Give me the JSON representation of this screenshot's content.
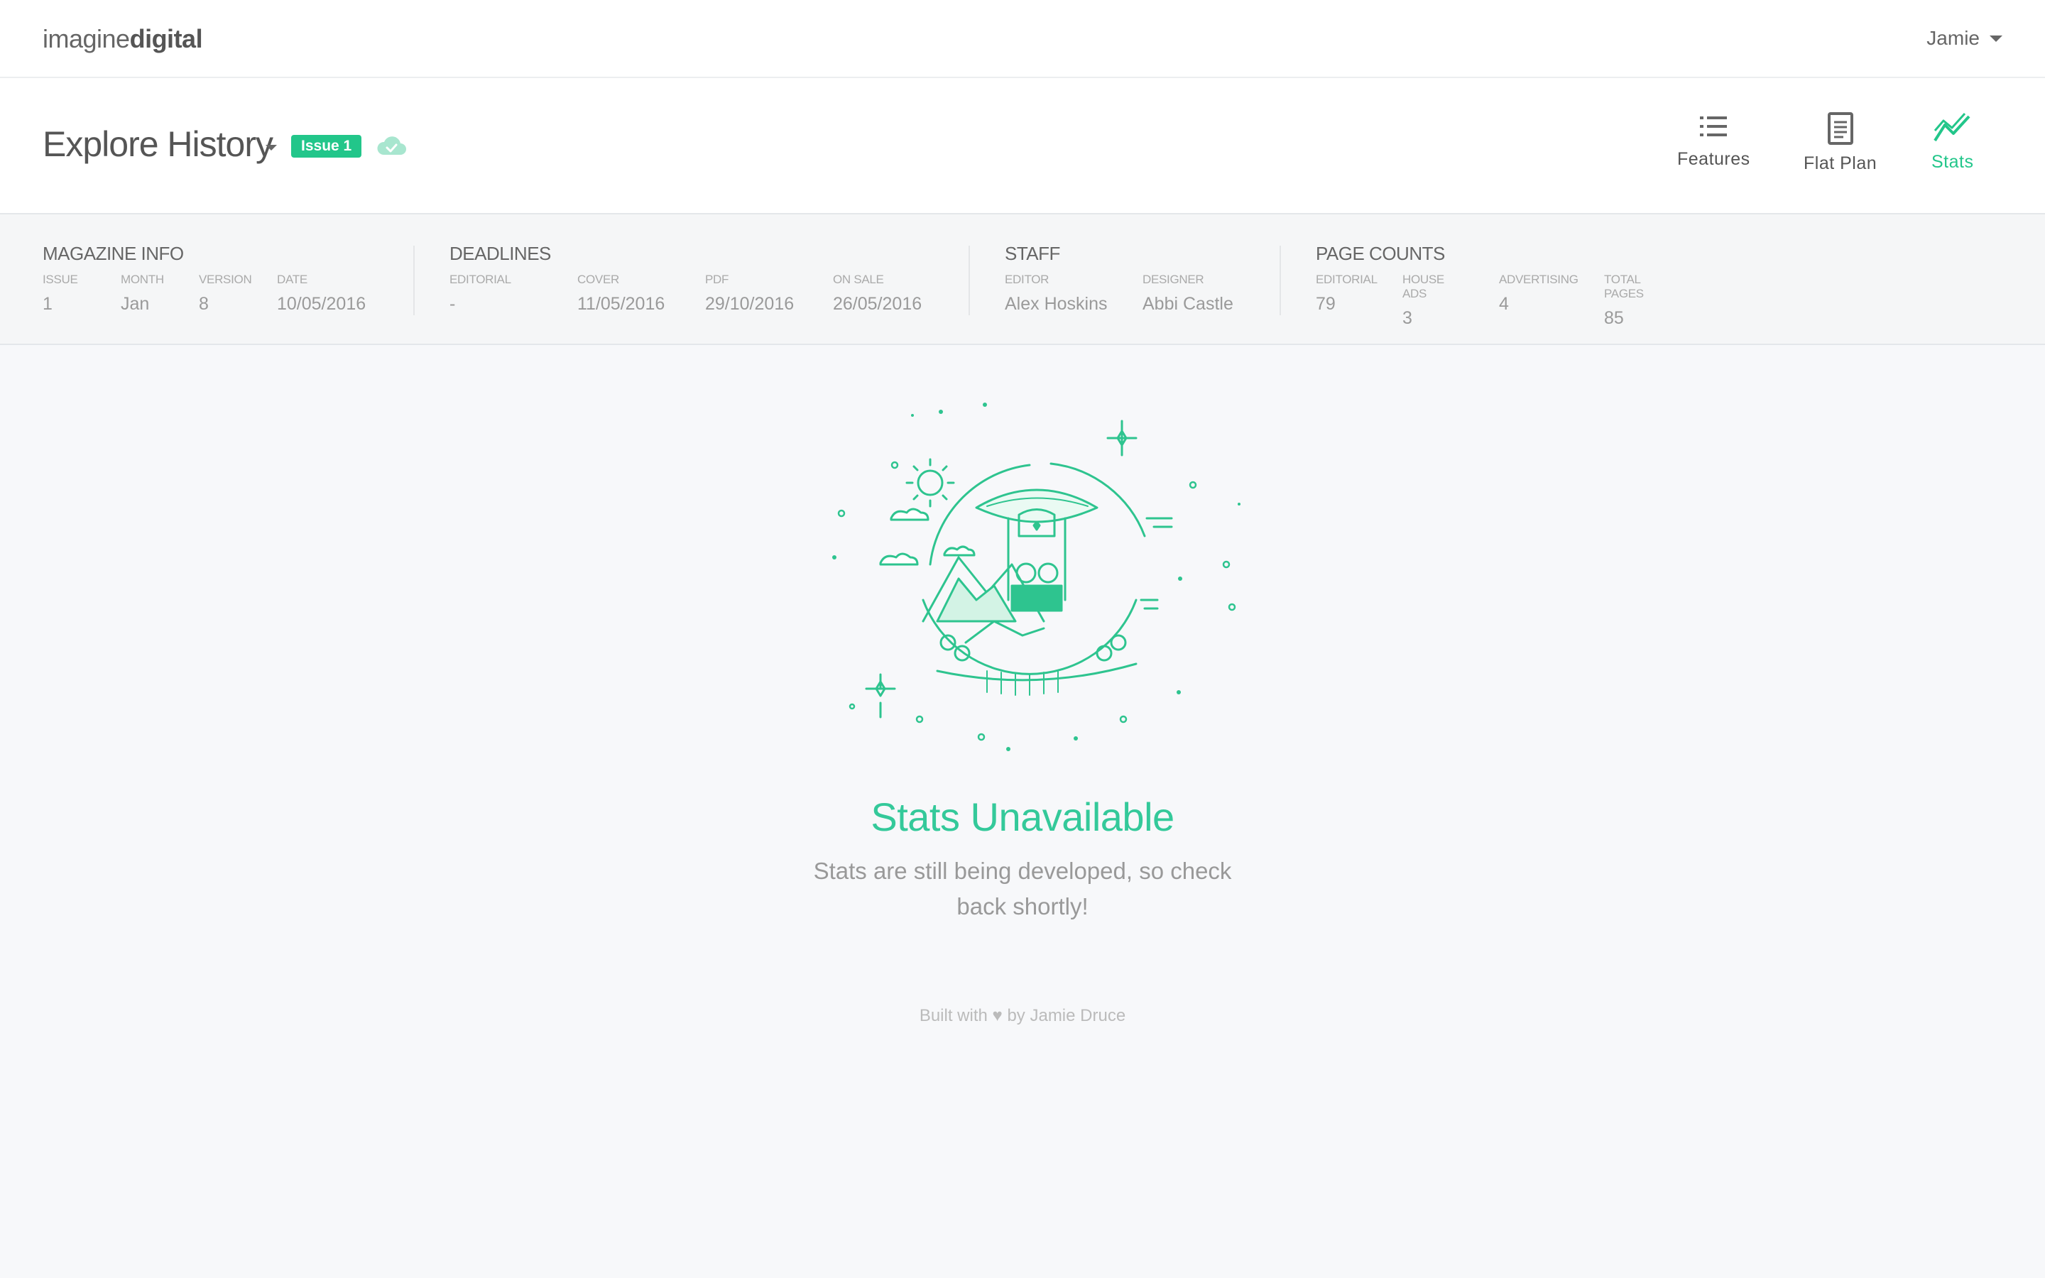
{
  "topbar": {
    "logo_light": "imagine",
    "logo_bold": "digital",
    "user_name": "Jamie"
  },
  "header": {
    "title": "Explore History",
    "badge": "Issue 1",
    "nav": [
      {
        "label": "Features",
        "icon": "list-icon",
        "active": false
      },
      {
        "label": "Flat Plan",
        "icon": "document-icon",
        "active": false
      },
      {
        "label": "Stats",
        "icon": "chart-line-icon",
        "active": true
      }
    ]
  },
  "info": {
    "magazine": {
      "title": "MAGAZINE INFO",
      "fields": [
        {
          "label": "ISSUE",
          "value": "1"
        },
        {
          "label": "MONTH",
          "value": "Jan"
        },
        {
          "label": "VERSION",
          "value": "8"
        },
        {
          "label": "DATE",
          "value": "10/05/2016"
        }
      ]
    },
    "deadlines": {
      "title": "DEADLINES",
      "fields": [
        {
          "label": "EDITORIAL",
          "value": "-"
        },
        {
          "label": "COVER",
          "value": "11/05/2016"
        },
        {
          "label": "PDF",
          "value": "29/10/2016"
        },
        {
          "label": "ON SALE",
          "value": "26/05/2016"
        }
      ]
    },
    "staff": {
      "title": "STAFF",
      "fields": [
        {
          "label": "EDITOR",
          "value": "Alex Hoskins"
        },
        {
          "label": "DESIGNER",
          "value": "Abbi Castle"
        }
      ]
    },
    "counts": {
      "title": "PAGE COUNTS",
      "fields": [
        {
          "label": "EDITORIAL",
          "value": "79"
        },
        {
          "label": "HOUSE ADS",
          "value": "3"
        },
        {
          "label": "ADVERTISING",
          "value": "4"
        },
        {
          "label": "TOTAL PAGES",
          "value": "85"
        }
      ]
    }
  },
  "empty_state": {
    "title": "Stats Unavailable",
    "message": "Stats are still being developed, so check back shortly!"
  },
  "footer": {
    "prefix": "Built with",
    "heart": "♥",
    "suffix": "by Jamie Druce"
  },
  "colors": {
    "accent": "#22c68a",
    "illustration": "#2ec48f"
  }
}
